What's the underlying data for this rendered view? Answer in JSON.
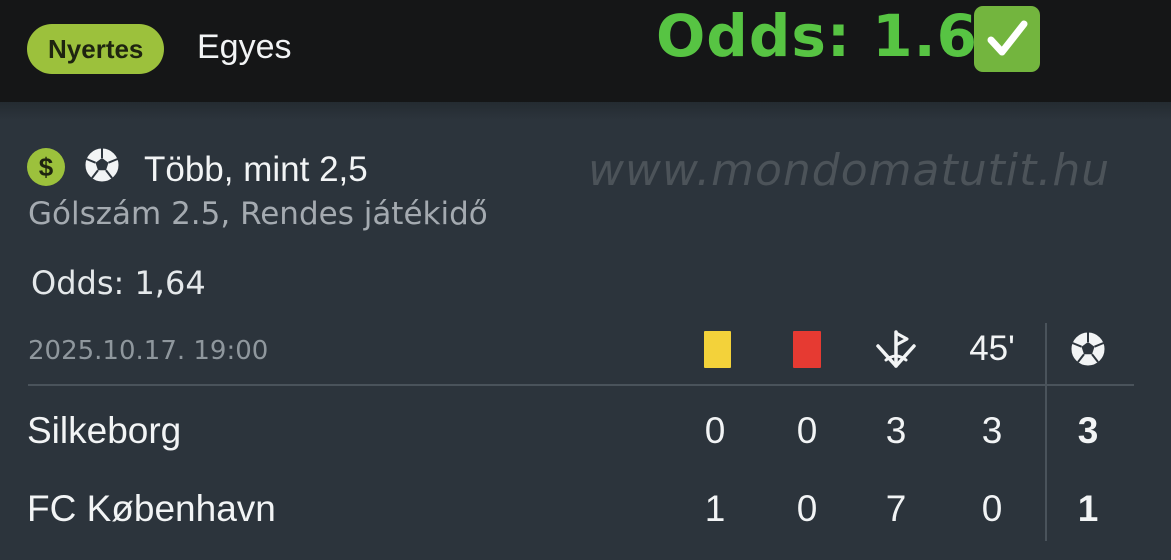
{
  "header": {
    "status_badge": "Nyertes",
    "bet_type": "Egyes",
    "odds_headline": "Odds: 1.64",
    "check_icon": "check-mark-icon",
    "accent_color": "#57c443"
  },
  "bet": {
    "market_title": "Több, mint 2,5",
    "market_subtitle": "Gólszám 2.5, Rendes játékidő",
    "odds_label": "Odds:",
    "odds_value": "1,64",
    "watermark": "www.mondomatutit.hu",
    "icons": [
      "dollar-icon",
      "football-icon"
    ]
  },
  "match": {
    "datetime": "2025.10.17.  19:00",
    "columns": {
      "yellow_cards": "yellow-card-icon",
      "red_cards": "red-card-icon",
      "corners": "corner-flag-icon",
      "half_time": "45'",
      "full_time": "football-icon"
    },
    "teams": [
      {
        "name": "Silkeborg",
        "yellow": "0",
        "red": "0",
        "corners": "3",
        "half_time": "3",
        "goals": "3"
      },
      {
        "name": "FC København",
        "yellow": "1",
        "red": "0",
        "corners": "7",
        "half_time": "0",
        "goals": "1"
      }
    ]
  }
}
